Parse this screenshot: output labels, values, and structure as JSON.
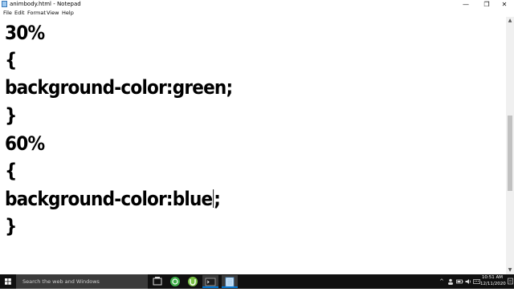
{
  "window": {
    "title": "animbody.html - Notepad",
    "minimize_glyph": "—",
    "maximize_glyph": "❐",
    "close_glyph": "✕"
  },
  "menu": [
    "File",
    "Edit",
    "Format",
    "View",
    "Help"
  ],
  "editor": {
    "lines": [
      "30%",
      "{",
      "background-color:green;",
      "}",
      "60%",
      "{",
      "background-color:blue",
      ";",
      "}"
    ]
  },
  "scrollbar": {
    "up_arrow": "▲",
    "down_arrow": "▼"
  },
  "taskbar": {
    "search_placeholder": "Search the web and Windows",
    "time": "10:51 AM",
    "date": "12/11/2020",
    "tray_chevron": "^",
    "accent_color": "#0078d7"
  },
  "icons": {
    "start": "windows-logo-icon",
    "task_view": "task-view-icon",
    "app1": "green-circle-app-icon",
    "app2": "utorrent-icon",
    "app3": "terminal-icon",
    "app4": "notepad-icon"
  }
}
